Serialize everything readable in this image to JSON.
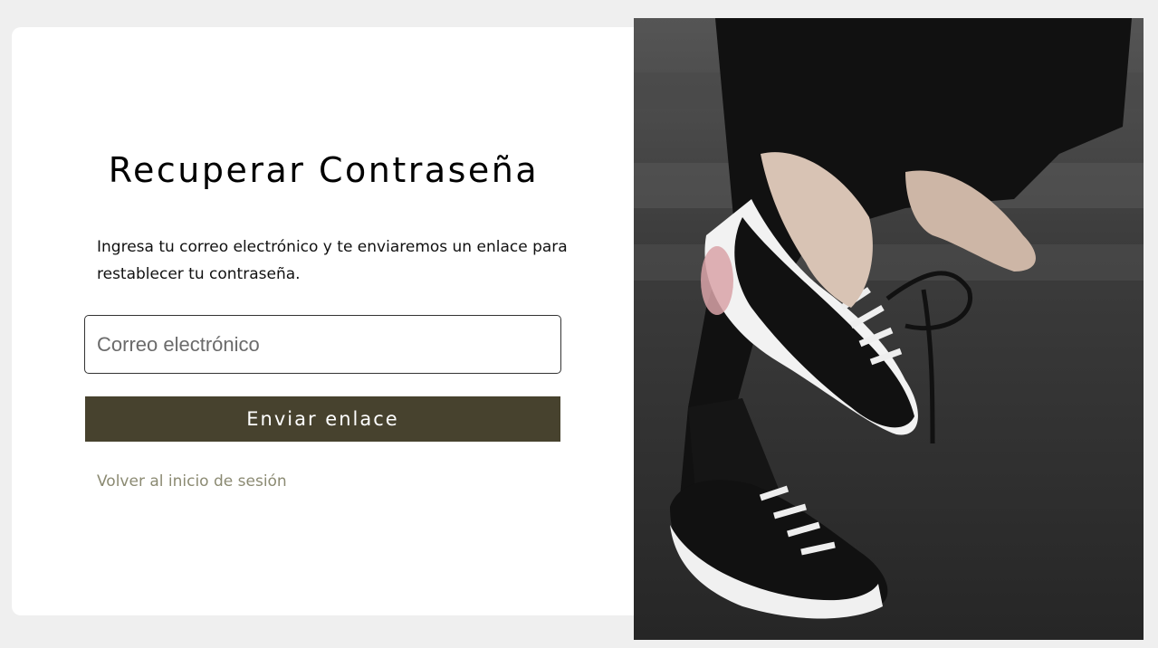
{
  "recovery": {
    "title": "Recuperar Contraseña",
    "description": "Ingresa tu correo electrónico y te enviaremos un enlace para restablecer tu contraseña.",
    "email_placeholder": "Correo electrónico",
    "email_value": "",
    "submit_label": "Enviar enlace",
    "back_link_label": "Volver al inicio de sesión"
  },
  "colors": {
    "page_background": "#efefef",
    "card_background": "#ffffff",
    "button_background": "#47422e",
    "link_color": "#8b8a72"
  },
  "image": {
    "subject": "person-tying-black-and-white-sneaker"
  }
}
